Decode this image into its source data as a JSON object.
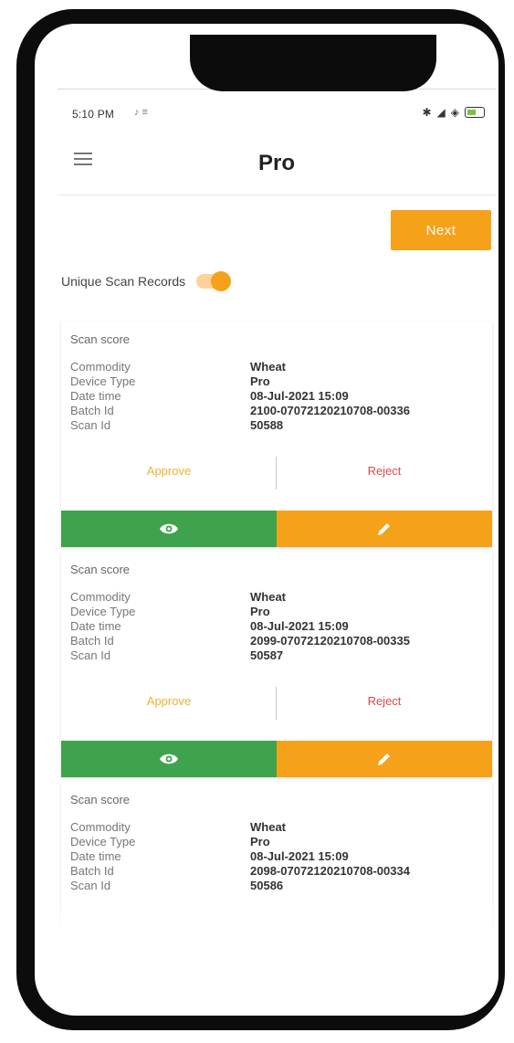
{
  "status": {
    "time": "5:10 PM",
    "notif": "♪ ≡"
  },
  "appbar": {
    "title": "Pro"
  },
  "controls": {
    "next_label": "Next",
    "unique_label": "Unique Scan Records",
    "unique_on": true
  },
  "labels": {
    "scan_score": "Scan score",
    "commodity": "Commodity",
    "device_type": "Device Type",
    "date_time": "Date time",
    "batch_id": "Batch Id",
    "scan_id": "Scan Id",
    "approve": "Approve",
    "reject": "Reject"
  },
  "records": [
    {
      "commodity": "Wheat",
      "device_type": "Pro",
      "date_time": "08-Jul-2021 15:09",
      "batch_id": "2100-07072120210708-00336",
      "scan_id": "50588"
    },
    {
      "commodity": "Wheat",
      "device_type": "Pro",
      "date_time": "08-Jul-2021 15:09",
      "batch_id": "2099-07072120210708-00335",
      "scan_id": "50587"
    },
    {
      "commodity": "Wheat",
      "device_type": "Pro",
      "date_time": "08-Jul-2021 15:09",
      "batch_id": "2098-07072120210708-00334",
      "scan_id": "50586"
    }
  ],
  "colors": {
    "accent": "#f6a11a",
    "view": "#3fa34d",
    "reject": "#e04848",
    "approve": "#f2b033"
  }
}
